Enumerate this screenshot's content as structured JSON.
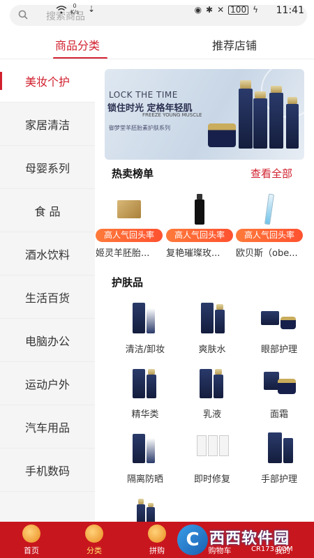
{
  "status_bar": {
    "search_placeholder": "搜索商品",
    "net_speed_value": "0",
    "net_speed_unit": "K/s",
    "battery": "100",
    "time": "11:41"
  },
  "tabs": [
    {
      "label": "商品分类",
      "active": true
    },
    {
      "label": "推荐店铺",
      "active": false
    }
  ],
  "sidebar": {
    "items": [
      {
        "label": "美妆个护",
        "active": true
      },
      {
        "label": "家居清洁"
      },
      {
        "label": "母婴系列"
      },
      {
        "label": "食 品"
      },
      {
        "label": "酒水饮料"
      },
      {
        "label": "生活百货"
      },
      {
        "label": "电脑办公"
      },
      {
        "label": "运动户外"
      },
      {
        "label": "汽车用品"
      },
      {
        "label": "手机数码"
      }
    ]
  },
  "banner": {
    "en_title": "LOCK THE TIME",
    "cn_title": "锁住时光 定格年轻肌",
    "en_subtitle": "FREEZE YOUNG MUSCLE",
    "series": "御梦堂羊胚胎素护肤系列"
  },
  "hot": {
    "title": "热卖榜单",
    "view_all": "查看全部",
    "items": [
      {
        "badge": "高人气回头率",
        "name": "姬灵羊胚胎..."
      },
      {
        "badge": "高人气回头率",
        "name": "复艳璀璨玫..."
      },
      {
        "badge": "高人气回头率",
        "name": "欧贝斯（obe..."
      }
    ]
  },
  "skincare": {
    "title": "护肤品",
    "categories": [
      {
        "label": "清洁/卸妆"
      },
      {
        "label": "爽肤水"
      },
      {
        "label": "眼部护理"
      },
      {
        "label": "精华类"
      },
      {
        "label": "乳液"
      },
      {
        "label": "面霜"
      },
      {
        "label": "隔离防晒"
      },
      {
        "label": "即时修复"
      },
      {
        "label": "手部护理"
      }
    ]
  },
  "bottom_nav": {
    "items": [
      {
        "label": "首页",
        "icon": "home-icon"
      },
      {
        "label": "分类",
        "icon": "category-icon",
        "active": true
      },
      {
        "label": "拼购",
        "icon": "group-buy-icon"
      },
      {
        "label": "购物车",
        "icon": "cart-icon"
      },
      {
        "label": "我的",
        "icon": "profile-icon"
      }
    ]
  },
  "watermark": {
    "logo_letter": "C",
    "text": "西西软件园",
    "url": "CR173.COM"
  },
  "colors": {
    "accent": "#d0202e",
    "bottom_nav_bg": "#c8161e",
    "badge": "#ff5a30"
  }
}
